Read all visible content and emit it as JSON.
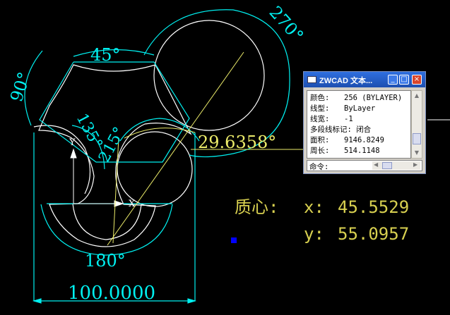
{
  "drawing": {
    "dim_angle_45": "45°",
    "dim_angle_90": "90°",
    "dim_angle_270": "270°",
    "dim_angle_135": "135°",
    "dim_angle_215": "215°",
    "dim_angle_180": "180°",
    "dim_linear": "100.0000",
    "measure_angle": "29.6358°",
    "ucs_x": "X",
    "ucs_y": "Y",
    "marker_color": "#0000ff"
  },
  "result": {
    "centroid_label": "质心:",
    "x_label": "x:",
    "x_value": "45.5529",
    "y_label": "y:",
    "y_value": "55.0957"
  },
  "text_window": {
    "title": "ZWCAD 文本...",
    "lines": [
      {
        "key": "颜色:",
        "value": "256 (BYLAYER)"
      },
      {
        "key": "线型:",
        "value": "ByLayer"
      },
      {
        "key": "线宽:",
        "value": "-1"
      },
      {
        "key": "多段线标记:",
        "value": "闭合"
      },
      {
        "key": "面积:",
        "value": "9146.8249"
      },
      {
        "key": "周长:",
        "value": "514.1148"
      }
    ],
    "command_label": "命令:"
  },
  "colors": {
    "dimension": "#00f0f0",
    "geometry": "#ffffff",
    "highlight": "#ecec6a",
    "titlebar": "#1d4fb0"
  }
}
